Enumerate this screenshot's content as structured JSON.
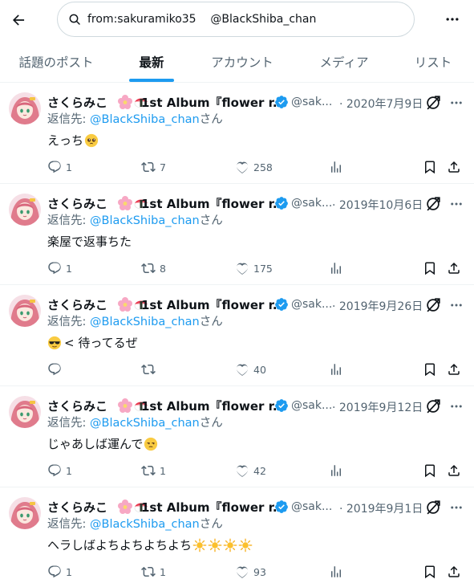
{
  "search": {
    "query": "from:sakuramiko35    @BlackShiba_chan"
  },
  "tabs": [
    {
      "label": "話題のポスト",
      "active": false
    },
    {
      "label": "最新",
      "active": true
    },
    {
      "label": "アカウント",
      "active": false
    },
    {
      "label": "メディア",
      "active": false
    },
    {
      "label": "リスト",
      "active": false
    }
  ],
  "author": {
    "name": "さくらみこ",
    "album": "1st Album『flower r...",
    "handle": "@sak...",
    "verified": true
  },
  "reply_to": {
    "prefix": "返信先: ",
    "mention": "@BlackShiba_chan",
    "suffix": "さん"
  },
  "tweets": [
    {
      "date": "· 2020年7月9日",
      "text": "えっち",
      "text_emoji": "pleading",
      "replies": "1",
      "reposts": "7",
      "likes": "258"
    },
    {
      "date": "· 2019年10月6日",
      "text": "楽屋で返事ちた",
      "text_emoji": "",
      "replies": "1",
      "reposts": "8",
      "likes": "175"
    },
    {
      "date": "· 2019年9月26日",
      "text": "< 待ってるぜ",
      "text_emoji": "sunglasses-lead",
      "replies": "",
      "reposts": "",
      "likes": "40"
    },
    {
      "date": "· 2019年9月12日",
      "text": "じゃあしば運んで",
      "text_emoji": "unamused",
      "replies": "1",
      "reposts": "1",
      "likes": "42"
    },
    {
      "date": "· 2019年9月1日",
      "text": "ヘラしばよちよちよちよち",
      "text_emoji": "suns-4",
      "replies": "1",
      "reposts": "1",
      "likes": "93"
    }
  ],
  "colors": {
    "accent": "#1d9bf0",
    "secondary_text": "#536471",
    "border": "#eff3f4",
    "verified": "#1d9bf0"
  }
}
